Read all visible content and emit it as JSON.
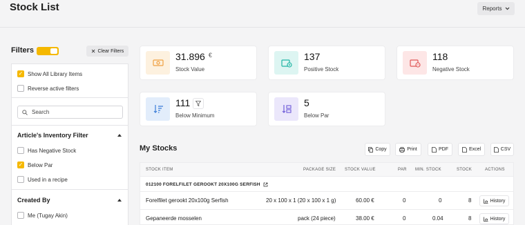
{
  "header": {
    "title": "Stock List",
    "reports_label": "Reports"
  },
  "filters": {
    "title": "Filters",
    "clear_label": "Clear Filters",
    "show_all_label": "Show All Library Items",
    "reverse_label": "Reverse active filters",
    "search_placeholder": "Search",
    "inventory_section": {
      "title": "Article's Inventory Filter",
      "items": [
        {
          "label": "Has Negative Stock",
          "checked": false
        },
        {
          "label": "Below Par",
          "checked": true
        },
        {
          "label": "Used in a recipe",
          "checked": false
        }
      ]
    },
    "created_section": {
      "title": "Created By",
      "items": [
        {
          "label": "Me (Tugay Akin)",
          "checked": false
        }
      ]
    }
  },
  "kpis": [
    {
      "value": "31.896",
      "unit": "€",
      "label": "Stock Value",
      "icon": "money-icon",
      "color": "#f0a040"
    },
    {
      "value": "137",
      "label": "Positive Stock",
      "icon": "box-plus-icon",
      "color": "#1fb5a4"
    },
    {
      "value": "118",
      "label": "Negative Stock",
      "icon": "box-minus-icon",
      "color": "#e05555"
    },
    {
      "value": "111",
      "label": "Below Minimum",
      "icon": "sort-down-icon",
      "color": "#3b7dd8"
    },
    {
      "value": "5",
      "label": "Below Par",
      "icon": "sort-box-icon",
      "color": "#6f5cd9"
    }
  ],
  "my_stocks": {
    "title": "My Stocks",
    "exports": [
      "Copy",
      "Print",
      "PDF",
      "Excel",
      "CSV"
    ],
    "columns": [
      "STOCK ITEM",
      "PACKAGE SIZE",
      "STOCK VALUE",
      "PAR",
      "MIN. STOCK",
      "STOCK",
      "ACTIONS"
    ],
    "group": "012100 FORELFILET GEROOKT 20X100G SERFISH",
    "rows": [
      {
        "item": "Forelfilet gerookt 20x100g Serfish",
        "package": "20 x 100 x 1 (20 x 100 x 1 g)",
        "value": "60.00 €",
        "par": "0",
        "min": "0",
        "stock": "8",
        "action": "History"
      },
      {
        "item": "Gepaneerde mosselen",
        "package": "pack (24 piece)",
        "value": "38.00 €",
        "par": "0",
        "min": "0.04",
        "stock": "8",
        "action": "History"
      }
    ]
  }
}
